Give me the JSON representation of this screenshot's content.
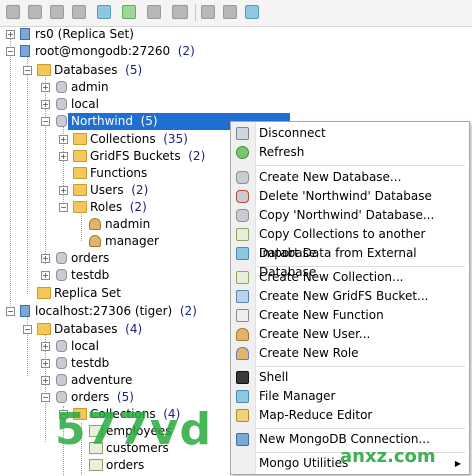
{
  "toolbar": {
    "buttons": [
      "connect-icon",
      "disconnect-icon",
      "refresh-icon",
      "edit-icon",
      "shell-icon",
      "sync-icon",
      "script-icon",
      "new-icon",
      "collection-icon",
      "user-icon",
      "role-icon"
    ]
  },
  "tree": {
    "rs0": {
      "label": "rs0 (Replica Set)"
    },
    "root": {
      "label": "root@mongodb:27260",
      "count": "(2)"
    },
    "databases1": {
      "label": "Databases",
      "count": "(5)"
    },
    "admin": {
      "label": "admin"
    },
    "local1": {
      "label": "local"
    },
    "northwind": {
      "label": "Northwind",
      "count": "(5)"
    },
    "collections1": {
      "label": "Collections",
      "count": "(35)"
    },
    "gridfs": {
      "label": "GridFS Buckets",
      "count": "(2)"
    },
    "functions": {
      "label": "Functions"
    },
    "users": {
      "label": "Users",
      "count": "(2)"
    },
    "roles": {
      "label": "Roles",
      "count": "(2)"
    },
    "nadmin": {
      "label": "nadmin"
    },
    "manager": {
      "label": "manager"
    },
    "orders1": {
      "label": "orders"
    },
    "testdb1": {
      "label": "testdb"
    },
    "replicaset": {
      "label": "Replica Set"
    },
    "localhost": {
      "label": "localhost:27306 (tiger)",
      "count": "(2)"
    },
    "databases2": {
      "label": "Databases",
      "count": "(4)"
    },
    "local2": {
      "label": "local"
    },
    "testdb2": {
      "label": "testdb"
    },
    "adventure": {
      "label": "adventure"
    },
    "orders2": {
      "label": "orders",
      "count": "(5)"
    },
    "collections2": {
      "label": "Collections",
      "count": "(4)"
    },
    "employees": {
      "label": "employees"
    },
    "customers": {
      "label": "customers"
    },
    "orders3": {
      "label": "orders"
    }
  },
  "menu": {
    "disconnect": "Disconnect",
    "refresh": "Refresh",
    "create_db": "Create New Database...",
    "delete_db": "Delete 'Northwind' Database",
    "copy_db": "Copy 'Northwind' Database...",
    "copy_coll": "Copy Collections to another Database",
    "import": "Import Data from External Database",
    "new_coll": "Create New Collection...",
    "new_gridfs": "Create New GridFS Bucket...",
    "new_func": "Create New Function",
    "new_user": "Create New User...",
    "new_role": "Create New Role",
    "shell": "Shell",
    "file_manager": "File Manager",
    "map_reduce": "Map-Reduce Editor",
    "new_conn": "New MongoDB Connection...",
    "utilities": "Mongo Utilities"
  },
  "watermark": {
    "text": "577vd",
    "sub": "anxz.com"
  },
  "colors": {
    "selection": "#1e6fcf",
    "count": "#1a237e",
    "folder": "#f3c75c"
  }
}
